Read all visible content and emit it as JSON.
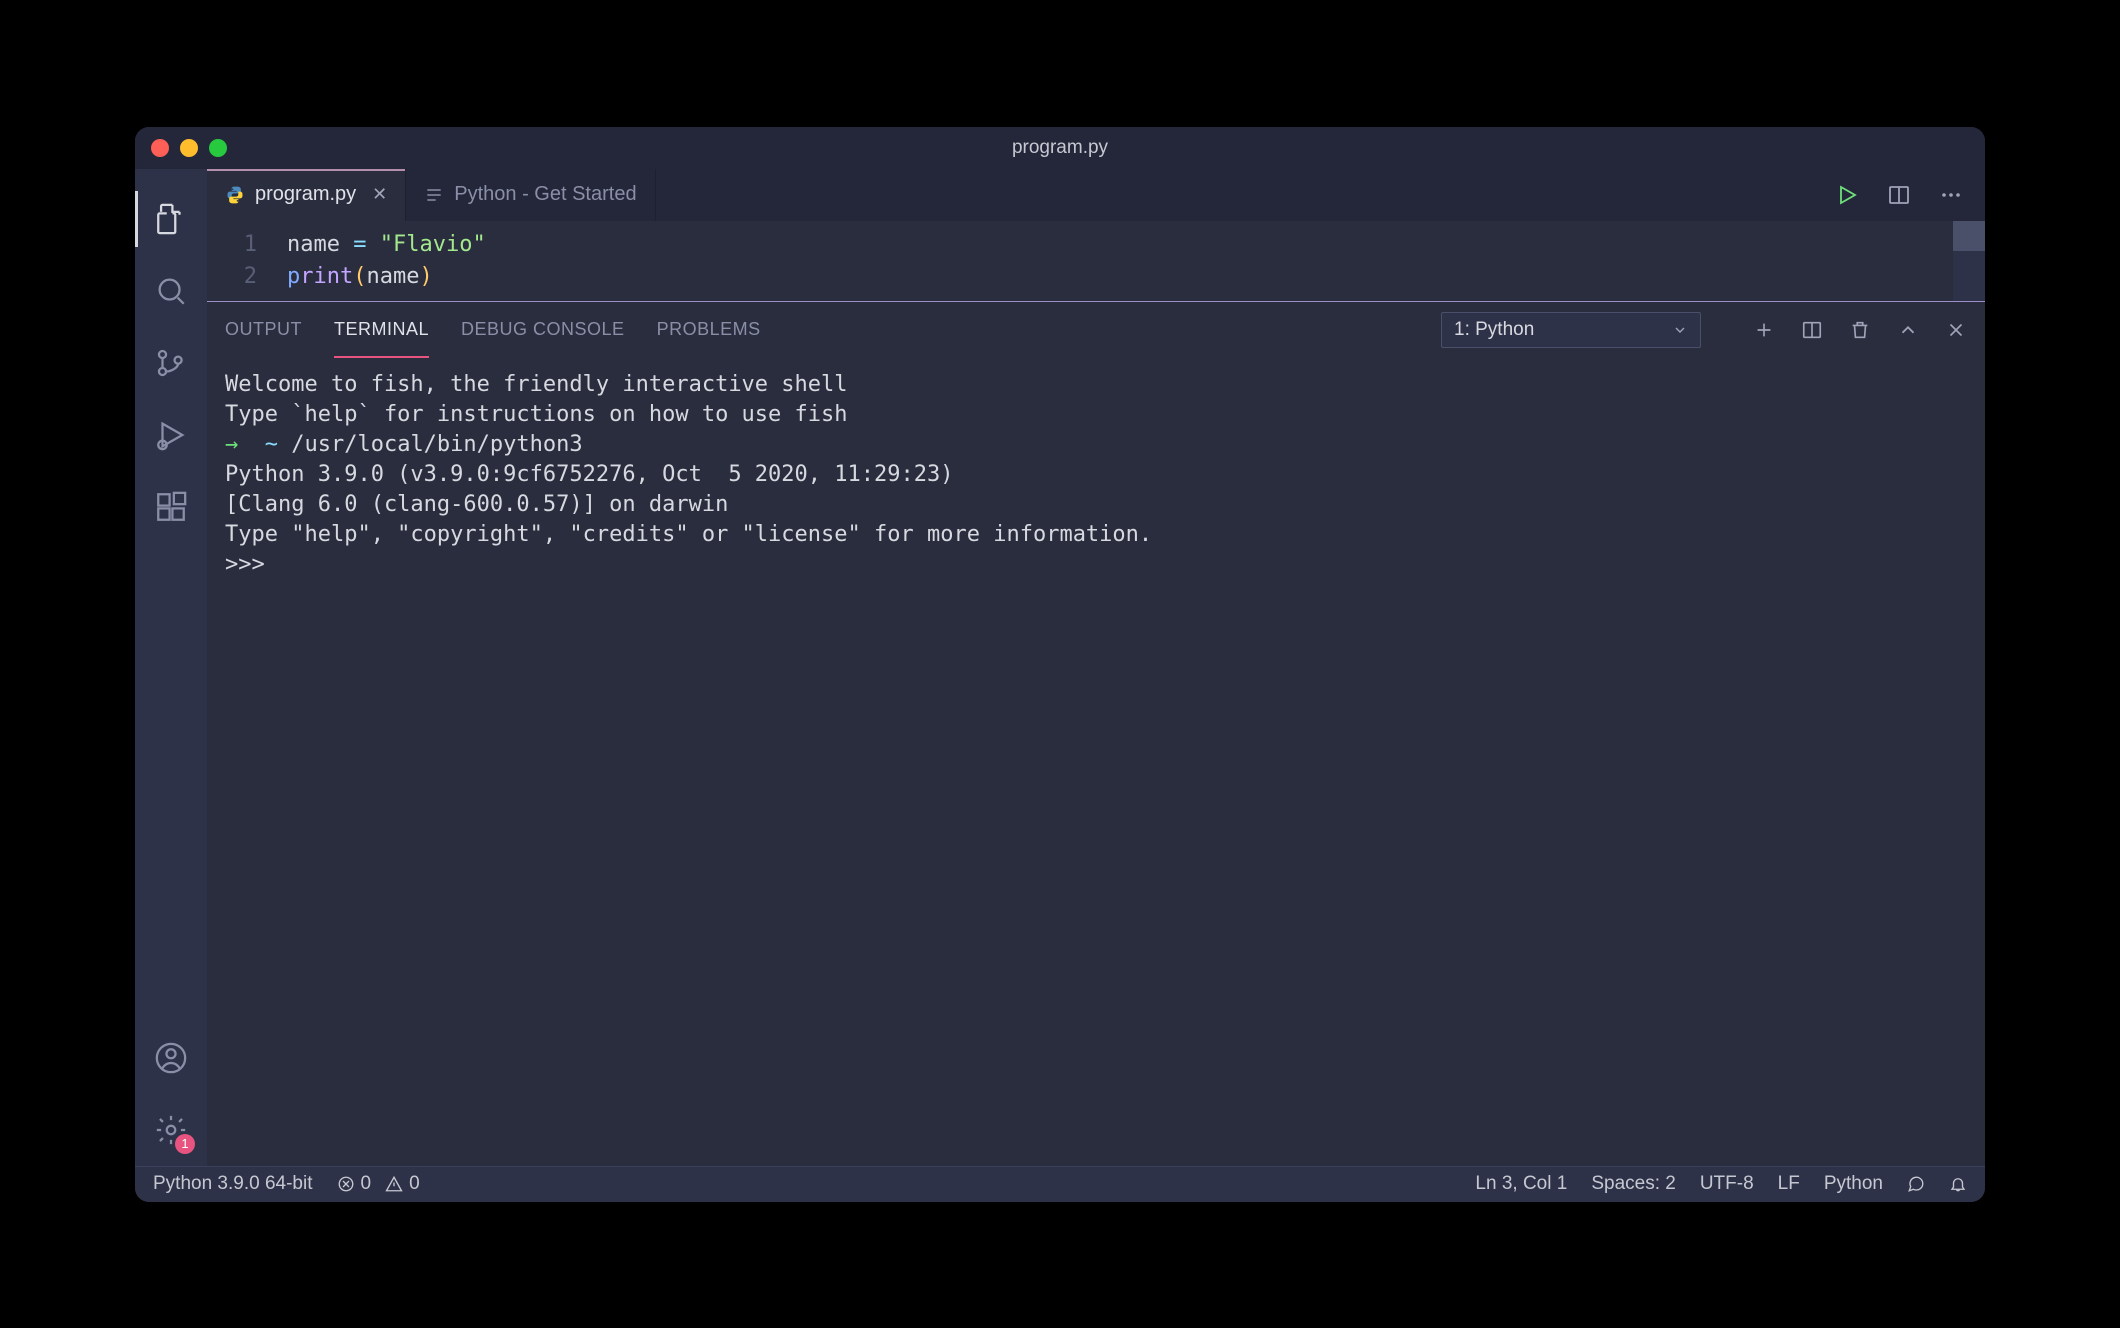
{
  "titlebar": {
    "title": "program.py"
  },
  "tabs": [
    {
      "label": "program.py",
      "active": true
    },
    {
      "label": "Python - Get Started",
      "active": false
    }
  ],
  "editor": {
    "lines": [
      {
        "num": "1",
        "var": "name",
        "op": " = ",
        "str": "\"Flavio\""
      },
      {
        "num": "2",
        "fn": "print",
        "arg": "name"
      }
    ]
  },
  "panel": {
    "tabs": {
      "output": "OUTPUT",
      "terminal": "TERMINAL",
      "debug": "DEBUG CONSOLE",
      "problems": "PROBLEMS"
    },
    "terminal_select": "1: Python",
    "terminal_content": {
      "l1": "Welcome to fish, the friendly interactive shell",
      "l2": "Type `help` for instructions on how to use fish",
      "l3_arrow": "→",
      "l3_tilde": "  ~ ",
      "l3_cmd": "/usr/local/bin/python3",
      "l4": "Python 3.9.0 (v3.9.0:9cf6752276, Oct  5 2020, 11:29:23)",
      "l5": "[Clang 6.0 (clang-600.0.57)] on darwin",
      "l6": "Type \"help\", \"copyright\", \"credits\" or \"license\" for more information.",
      "l7": ">>>"
    }
  },
  "statusbar": {
    "python": "Python 3.9.0 64-bit",
    "errors": "0",
    "warnings": "0",
    "ln_col": "Ln 3, Col 1",
    "spaces": "Spaces: 2",
    "encoding": "UTF-8",
    "eol": "LF",
    "language": "Python"
  },
  "activity": {
    "settings_badge": "1"
  }
}
